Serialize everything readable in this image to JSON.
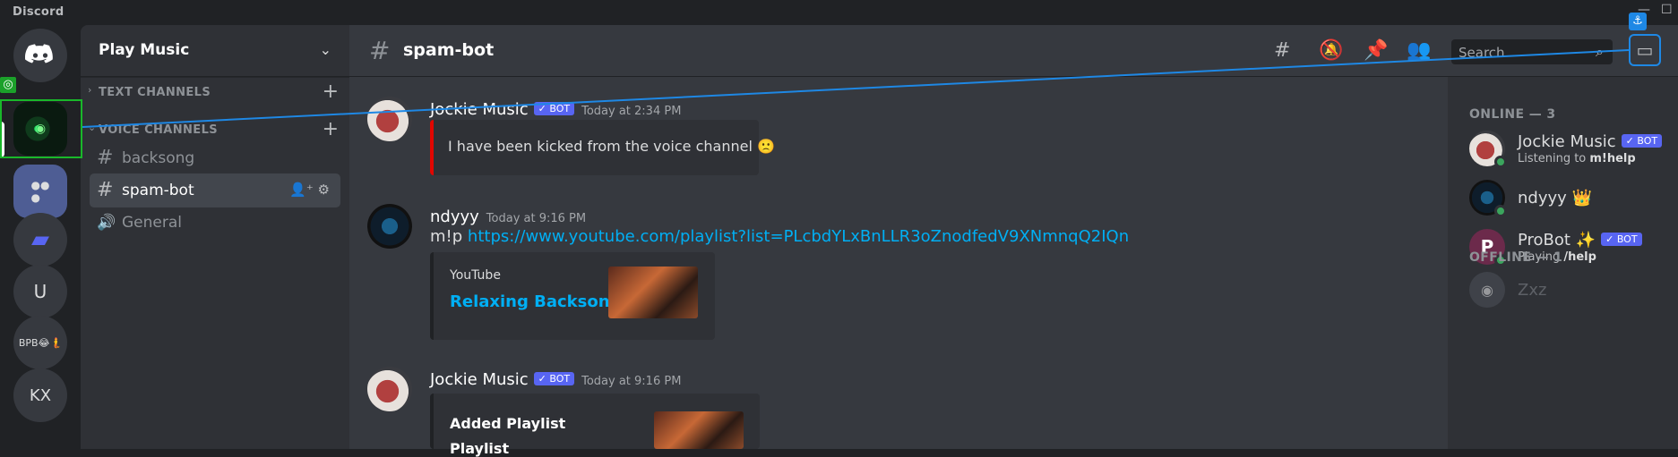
{
  "window": {
    "title": "Discord"
  },
  "rail": {
    "items": [
      {
        "label": "",
        "icon": "discord-logo"
      },
      {
        "label": "",
        "icon": "active-server"
      },
      {
        "label": "",
        "icon": "server-group"
      },
      {
        "label": "",
        "icon": "folder"
      },
      {
        "label": "U"
      },
      {
        "label": "BPB😂🧜"
      },
      {
        "label": "KX"
      }
    ]
  },
  "guild": {
    "name": "Play Music"
  },
  "categories": {
    "text": "TEXT CHANNELS",
    "voice": "VOICE CHANNELS"
  },
  "channels": [
    {
      "name": "backsong",
      "icon": "#"
    },
    {
      "name": "spam-bot",
      "icon": "#"
    },
    {
      "name": "General",
      "icon": "speaker"
    }
  ],
  "topbar": {
    "channel": "spam-bot",
    "search_placeholder": "Search"
  },
  "messages": [
    {
      "author": "Jockie Music",
      "bot": "✓ BOT",
      "time": "Today at 2:34 PM",
      "embed_text": "I have been kicked from the voice channel 🙁"
    },
    {
      "author": "ndyyy",
      "time": "Today at 9:16 PM",
      "prefix": "m!p",
      "link": "https://www.youtube.com/playlist?list=PLcbdYLxBnLLR3oZnodfedV9XNmnqQ2IQn",
      "embed_provider": "YouTube",
      "embed_title": "Relaxing Backsong"
    },
    {
      "author": "Jockie Music",
      "bot": "✓ BOT",
      "time": "Today at 9:16 PM",
      "embed_title": "Added Playlist",
      "embed_sub": "Playlist"
    }
  ],
  "members": {
    "online_heading": "ONLINE — 3",
    "offline_heading": "OFFLINE — 1",
    "online": [
      {
        "name": "Jockie Music",
        "bot": "✓ BOT",
        "activity_prefix": "Listening to ",
        "activity": "m!help"
      },
      {
        "name": "ndyyy 👑"
      },
      {
        "name": "ProBot ✨",
        "bot": "✓ BOT",
        "activity_prefix": "Playing ",
        "activity": "/help"
      }
    ],
    "offline": [
      {
        "name": "Zxz"
      }
    ]
  },
  "colors": {
    "accent": "#5865f2",
    "link": "#00aff4",
    "online": "#3ba55d",
    "embed_red": "#e10600",
    "overlay_blue": "#1e88e5",
    "overlay_green": "#19b82a"
  }
}
